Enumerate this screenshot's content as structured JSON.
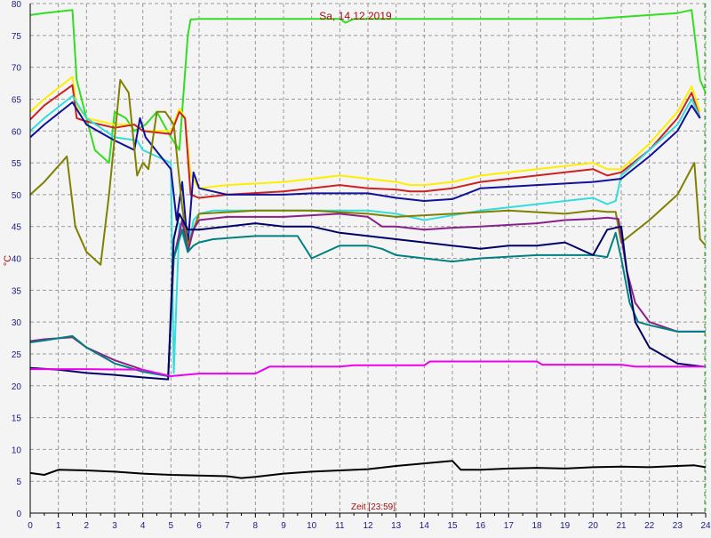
{
  "chart_data": {
    "type": "line",
    "title": "Sa, 14.12.2019",
    "xlabel": "Zeit [23:59]",
    "ylabel": "°C",
    "xlim": [
      0,
      24
    ],
    "ylim": [
      0,
      80
    ],
    "xticks": [
      "0",
      "1",
      "2",
      "3",
      "4",
      "5",
      "6",
      "7",
      "8",
      "9",
      "10",
      "11",
      "12",
      "13",
      "14",
      "15",
      "16",
      "17",
      "18",
      "19",
      "20",
      "21",
      "22",
      "23",
      "24"
    ],
    "yticks": [
      "0",
      "5",
      "10",
      "15",
      "20",
      "25",
      "30",
      "35",
      "40",
      "45",
      "50",
      "55",
      "60",
      "65",
      "70",
      "75",
      "80"
    ],
    "grid": true,
    "series": [
      {
        "color": "#33dd22",
        "x": [
          0,
          0.5,
          1.5,
          1.65,
          2,
          2.3,
          2.8,
          3,
          3.4,
          3.7,
          4.1,
          4.5,
          5,
          5.3,
          5.6,
          5.7,
          6,
          8,
          10,
          11,
          11.2,
          11.5,
          12,
          15,
          17,
          19,
          20,
          23,
          23.5,
          23.8,
          24
        ],
        "y": [
          78.2,
          78.5,
          79,
          68,
          62,
          57,
          55,
          63,
          62,
          60,
          61,
          63,
          59,
          57,
          75,
          77.5,
          77.6,
          77.6,
          77.6,
          77.6,
          77,
          77.6,
          77.6,
          77.6,
          77.6,
          77.6,
          77.6,
          78.5,
          79,
          68,
          66
        ]
      },
      {
        "color": "#ffee00",
        "x": [
          0,
          0.5,
          1.5,
          1.65,
          2,
          3,
          3.7,
          4,
          5,
          5.3,
          5.5,
          5.7,
          6,
          7,
          9,
          11,
          12,
          13,
          13.5,
          14,
          15,
          16,
          18,
          19,
          20,
          20.5,
          21,
          22,
          23,
          23.5,
          23.8
        ],
        "y": [
          63,
          65,
          68.5,
          64,
          62,
          61,
          61,
          60,
          60,
          63.5,
          62,
          53,
          51,
          51.5,
          52,
          53,
          52.5,
          52,
          51.5,
          51.5,
          52,
          53,
          54,
          54.5,
          55,
          54,
          54,
          58,
          63,
          67,
          63
        ]
      },
      {
        "color": "#cc2222",
        "x": [
          0,
          0.5,
          1.5,
          1.65,
          2,
          3,
          3.7,
          4,
          5,
          5.3,
          5.5,
          5.7,
          6,
          7,
          9,
          11,
          12,
          13,
          13.5,
          14,
          15,
          16,
          18,
          19,
          20,
          20.5,
          21,
          22,
          23,
          23.5,
          23.8
        ],
        "y": [
          61.8,
          64,
          67.2,
          62,
          61.5,
          60.5,
          61,
          60,
          59.5,
          63,
          62,
          50,
          49.5,
          50,
          50.5,
          51.5,
          51,
          50.8,
          50.5,
          50.5,
          51,
          52,
          53,
          53.5,
          54,
          53,
          53.5,
          57,
          62,
          66,
          62
        ]
      },
      {
        "color": "#33dddd",
        "x": [
          0,
          0.5,
          1.5,
          2,
          3,
          3.8,
          4,
          5,
          5.1,
          5.3,
          5.6,
          5.8,
          6,
          6.5,
          9,
          12,
          13,
          14,
          16,
          18,
          19,
          20,
          20.5,
          20.8,
          21,
          22,
          23,
          23.5,
          23.8
        ],
        "y": [
          60,
          62,
          65.5,
          62,
          59,
          58.5,
          57,
          55,
          22,
          45.5,
          41,
          46,
          47,
          47.5,
          47.5,
          47.5,
          47,
          46,
          47.5,
          48.5,
          49,
          49.5,
          48.5,
          49,
          53,
          57,
          61,
          65,
          62
        ]
      },
      {
        "color": "#111199",
        "x": [
          0,
          0.5,
          1.5,
          2,
          3,
          3.7,
          3.9,
          4.1,
          5,
          5.2,
          5.4,
          5.6,
          5.8,
          6,
          7,
          9,
          10,
          11,
          12,
          13,
          14,
          15,
          16,
          18,
          20,
          21,
          22,
          23,
          23.5,
          23.8
        ],
        "y": [
          59,
          61,
          64.5,
          61,
          58.5,
          57,
          62,
          59,
          54,
          46,
          52,
          42,
          53.5,
          51,
          50,
          50,
          50.2,
          50.2,
          50.2,
          49.5,
          49,
          49.3,
          51,
          51.5,
          52,
          52.5,
          56,
          60,
          64,
          62
        ]
      },
      {
        "color": "#808000",
        "x": [
          0,
          0.5,
          1.3,
          1.6,
          2,
          2.5,
          2.8,
          3.2,
          3.5,
          3.8,
          4,
          4.2,
          4.5,
          4.8,
          5.1,
          5.4,
          5.6,
          6,
          8,
          10,
          12,
          13,
          15,
          17,
          19,
          20,
          20.5,
          20.8,
          21,
          22,
          23,
          23.6,
          23.8,
          24
        ],
        "y": [
          50,
          52,
          56,
          45,
          41,
          39,
          50,
          68,
          66,
          53,
          55,
          54,
          63,
          63,
          61,
          48,
          42,
          47,
          47.5,
          47.5,
          47,
          46.5,
          47,
          47.5,
          47,
          47.5,
          47.3,
          47.3,
          42.5,
          46,
          50,
          55,
          43,
          42
        ]
      },
      {
        "color": "#882288",
        "x": [
          0,
          0.5,
          1.5,
          2,
          3,
          4,
          4.9,
          5.1,
          5.4,
          5.6,
          5.8,
          6,
          7,
          9,
          11,
          12,
          12.5,
          13,
          14,
          15,
          16,
          18,
          19,
          20,
          20.5,
          20.9,
          21.2,
          21.5,
          22,
          23,
          24
        ],
        "y": [
          27,
          27.3,
          27.6,
          26,
          24,
          22.5,
          21.5,
          40,
          46,
          41,
          44.5,
          46,
          46.5,
          46.5,
          47,
          46.5,
          45,
          45,
          44.5,
          44.8,
          45,
          45.5,
          46,
          46.2,
          46.4,
          46.2,
          38,
          33,
          30,
          28.5,
          28.5
        ]
      },
      {
        "color": "#008080",
        "x": [
          0,
          0.5,
          1.5,
          2,
          3,
          4,
          4.9,
          5.1,
          5.4,
          5.6,
          5.8,
          6,
          6.5,
          8,
          9.5,
          10,
          11,
          12,
          12.5,
          13,
          14,
          15,
          16,
          18,
          19,
          20,
          20.5,
          20.8,
          21,
          21.3,
          21.6,
          22,
          23,
          24
        ],
        "y": [
          26.8,
          27.1,
          27.8,
          26,
          23.5,
          22.2,
          21.5,
          40,
          44.5,
          41,
          42,
          42.5,
          43,
          43.5,
          43.5,
          40,
          42,
          42,
          41.5,
          40.5,
          40,
          39.5,
          40,
          40.5,
          40.5,
          40.5,
          40.2,
          44,
          40,
          33,
          30,
          29.5,
          28.5,
          28.5
        ]
      },
      {
        "color": "#000066",
        "x": [
          0,
          1,
          2,
          3,
          4,
          4.9,
          5.1,
          5.3,
          5.6,
          5.8,
          6,
          7,
          8,
          9,
          10,
          11,
          12,
          13,
          15,
          16,
          17,
          18,
          19,
          20,
          20.5,
          21,
          21.2,
          21.5,
          22,
          23,
          23.9
        ],
        "y": [
          22.8,
          22.5,
          22,
          21.7,
          21.3,
          21,
          43,
          47,
          44.5,
          44.5,
          44.5,
          45,
          45.5,
          45,
          45,
          44,
          43.5,
          43,
          42,
          41.5,
          42,
          42,
          42.5,
          40.5,
          44.5,
          45,
          38,
          30,
          26,
          23.5,
          23
        ]
      },
      {
        "color": "#ee00ee",
        "x": [
          0,
          2,
          4,
          5,
          6,
          8,
          8.5,
          11,
          11.5,
          14,
          14.2,
          18,
          18.2,
          21,
          21.5,
          24
        ],
        "y": [
          22.6,
          22.6,
          22.5,
          21.5,
          21.9,
          21.9,
          23,
          23,
          23.2,
          23.2,
          23.8,
          23.8,
          23.3,
          23.3,
          23,
          23
        ]
      },
      {
        "color": "#000000",
        "x": [
          0,
          0.5,
          1,
          2,
          3,
          4,
          5,
          6,
          7,
          7.5,
          8,
          9,
          10,
          11,
          12,
          13,
          14,
          15,
          15.3,
          16,
          17,
          18,
          19,
          20,
          21,
          22,
          23,
          23.6,
          24
        ],
        "y": [
          6.3,
          6,
          6.8,
          6.7,
          6.5,
          6.2,
          6,
          5.9,
          5.8,
          5.5,
          5.7,
          6.2,
          6.5,
          6.7,
          6.9,
          7.4,
          7.8,
          8.2,
          6.8,
          6.8,
          7,
          7.1,
          7,
          7.2,
          7.3,
          7.2,
          7.4,
          7.5,
          7.2
        ]
      }
    ]
  }
}
